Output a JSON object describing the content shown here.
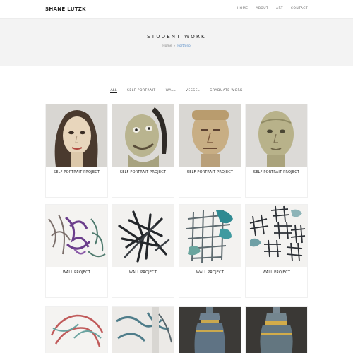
{
  "header": {
    "brand": "SHANE LUTZK",
    "nav": [
      "HOME",
      "ABOUT",
      "ART",
      "CONTACT"
    ]
  },
  "banner": {
    "title": "STUDENT WORK",
    "breadcrumb": [
      "Home",
      "Portfolio"
    ]
  },
  "filters": [
    "ALL",
    "SELF PORTRAIT",
    "WALL",
    "VESSEL",
    "GRADUATE WORK"
  ],
  "portfolio": [
    {
      "caption": "SELF PORTRAIT PROJECT",
      "image": "ceramic-portrait-woman"
    },
    {
      "caption": "SELF PORTRAIT PROJECT",
      "image": "ceramic-portrait-grimace"
    },
    {
      "caption": "SELF PORTRAIT PROJECT",
      "image": "ceramic-portrait-man"
    },
    {
      "caption": "SELF PORTRAIT PROJECT",
      "image": "ceramic-portrait-stone"
    },
    {
      "caption": "WALL PROJECT",
      "image": "wall-purple-tangle"
    },
    {
      "caption": "WALL PROJECT",
      "image": "wall-black-branches"
    },
    {
      "caption": "WALL PROJECT",
      "image": "wall-teal-grid"
    },
    {
      "caption": "WALL PROJECT",
      "image": "wall-dark-grid-clusters"
    },
    {
      "caption": "",
      "image": "wall-red-wreath"
    },
    {
      "caption": "",
      "image": "wall-blue-tangle"
    },
    {
      "caption": "",
      "image": "vessel-urn-blue"
    },
    {
      "caption": "",
      "image": "vessel-urn-gold"
    }
  ],
  "colors": {
    "accent": "#5b8fc9",
    "banner_bg": "#f3f3f3"
  }
}
